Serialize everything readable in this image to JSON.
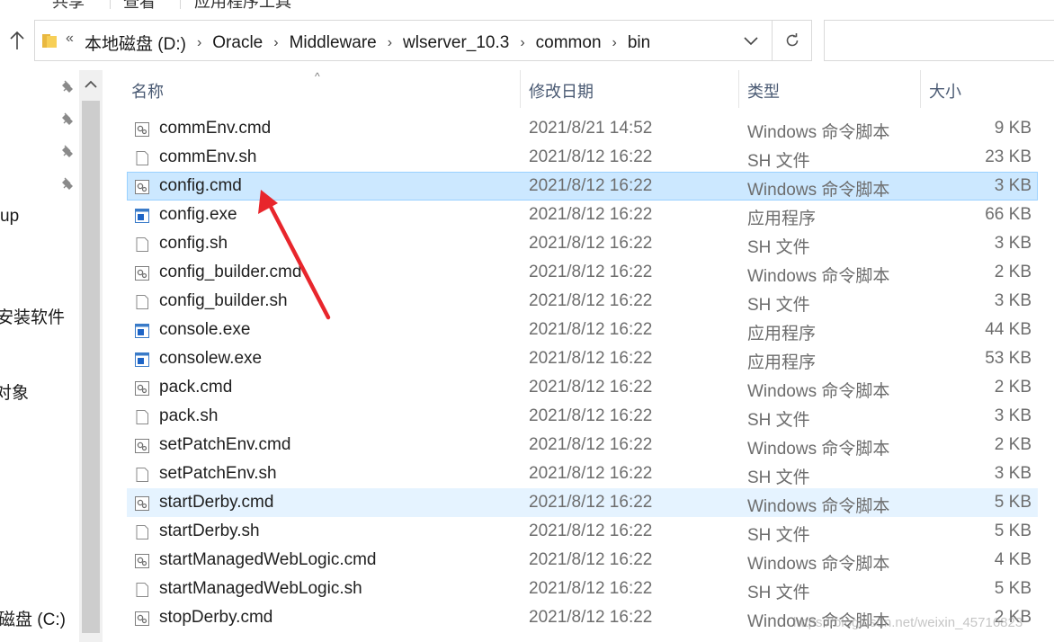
{
  "ribbon": {
    "tabs": [
      "共享",
      "查看",
      "应用程序工具"
    ]
  },
  "address": {
    "overflow_glyph": "«",
    "crumbs": [
      "本地磁盘 (D:)",
      "Oracle",
      "Middleware",
      "wlserver_10.3",
      "common",
      "bin"
    ],
    "separator": "›",
    "search_placeholder": ""
  },
  "nav": {
    "labels": [
      "up",
      "安装软件",
      "对象",
      "磁盘 (C:)"
    ]
  },
  "columns": {
    "name": "名称",
    "date": "修改日期",
    "type": "类型",
    "size": "大小"
  },
  "files": [
    {
      "name": "commEnv.cmd",
      "date": "2021/8/21 14:52",
      "type": "Windows 命令脚本",
      "size": "9 KB",
      "icon": "cmd-script-icon",
      "state": ""
    },
    {
      "name": "commEnv.sh",
      "date": "2021/8/12 16:22",
      "type": "SH 文件",
      "size": "23 KB",
      "icon": "sh-file-icon",
      "state": ""
    },
    {
      "name": "config.cmd",
      "date": "2021/8/12 16:22",
      "type": "Windows 命令脚本",
      "size": "3 KB",
      "icon": "cmd-script-icon",
      "state": "selected"
    },
    {
      "name": "config.exe",
      "date": "2021/8/12 16:22",
      "type": "应用程序",
      "size": "66 KB",
      "icon": "exe-app-icon",
      "state": ""
    },
    {
      "name": "config.sh",
      "date": "2021/8/12 16:22",
      "type": "SH 文件",
      "size": "3 KB",
      "icon": "sh-file-icon",
      "state": ""
    },
    {
      "name": "config_builder.cmd",
      "date": "2021/8/12 16:22",
      "type": "Windows 命令脚本",
      "size": "2 KB",
      "icon": "cmd-script-icon",
      "state": ""
    },
    {
      "name": "config_builder.sh",
      "date": "2021/8/12 16:22",
      "type": "SH 文件",
      "size": "3 KB",
      "icon": "sh-file-icon",
      "state": ""
    },
    {
      "name": "console.exe",
      "date": "2021/8/12 16:22",
      "type": "应用程序",
      "size": "44 KB",
      "icon": "exe-app-icon",
      "state": ""
    },
    {
      "name": "consolew.exe",
      "date": "2021/8/12 16:22",
      "type": "应用程序",
      "size": "53 KB",
      "icon": "exe-app-icon",
      "state": ""
    },
    {
      "name": "pack.cmd",
      "date": "2021/8/12 16:22",
      "type": "Windows 命令脚本",
      "size": "2 KB",
      "icon": "cmd-script-icon",
      "state": ""
    },
    {
      "name": "pack.sh",
      "date": "2021/8/12 16:22",
      "type": "SH 文件",
      "size": "3 KB",
      "icon": "sh-file-icon",
      "state": ""
    },
    {
      "name": "setPatchEnv.cmd",
      "date": "2021/8/12 16:22",
      "type": "Windows 命令脚本",
      "size": "2 KB",
      "icon": "cmd-script-icon",
      "state": ""
    },
    {
      "name": "setPatchEnv.sh",
      "date": "2021/8/12 16:22",
      "type": "SH 文件",
      "size": "3 KB",
      "icon": "sh-file-icon",
      "state": ""
    },
    {
      "name": "startDerby.cmd",
      "date": "2021/8/12 16:22",
      "type": "Windows 命令脚本",
      "size": "5 KB",
      "icon": "cmd-script-icon",
      "state": "hover"
    },
    {
      "name": "startDerby.sh",
      "date": "2021/8/12 16:22",
      "type": "SH 文件",
      "size": "5 KB",
      "icon": "sh-file-icon",
      "state": ""
    },
    {
      "name": "startManagedWebLogic.cmd",
      "date": "2021/8/12 16:22",
      "type": "Windows 命令脚本",
      "size": "4 KB",
      "icon": "cmd-script-icon",
      "state": ""
    },
    {
      "name": "startManagedWebLogic.sh",
      "date": "2021/8/12 16:22",
      "type": "SH 文件",
      "size": "5 KB",
      "icon": "sh-file-icon",
      "state": ""
    },
    {
      "name": "stopDerby.cmd",
      "date": "2021/8/12 16:22",
      "type": "Windows 命令脚本",
      "size": "2 KB",
      "icon": "cmd-script-icon",
      "state": ""
    }
  ],
  "watermark": "https://blog.csdn.net/weixin_45716823",
  "colors": {
    "selected_bg": "#cce8ff",
    "selected_border": "#99d1ff",
    "hover_bg": "#e5f3ff",
    "annotation_arrow": "#e8262c",
    "header_text": "#4a5a73"
  }
}
